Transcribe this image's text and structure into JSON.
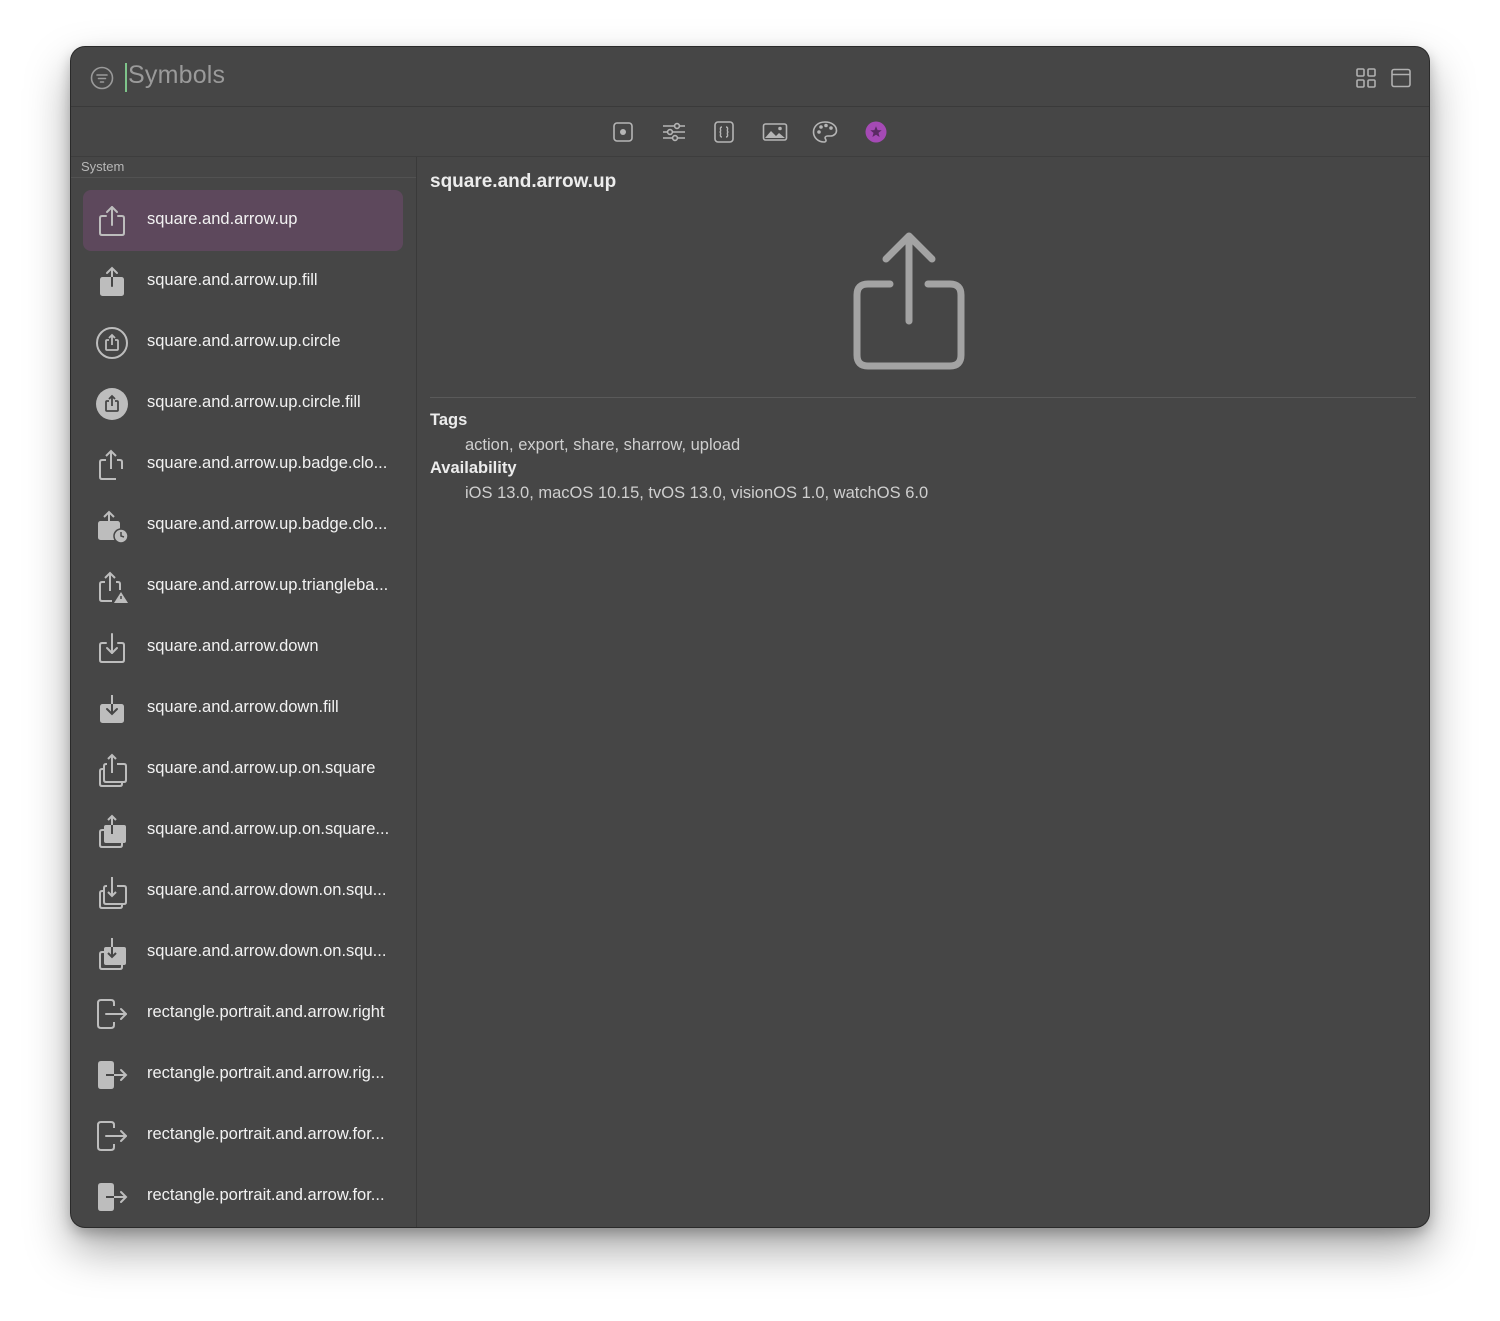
{
  "search": {
    "text": "Symbols"
  },
  "section": {
    "label": "System"
  },
  "symbols": [
    {
      "name": "square.and.arrow.up",
      "icon": "square-arrow-up-icon"
    },
    {
      "name": "square.and.arrow.up.fill",
      "icon": "square-arrow-up-fill-icon"
    },
    {
      "name": "square.and.arrow.up.circle",
      "icon": "square-arrow-up-circle-icon"
    },
    {
      "name": "square.and.arrow.up.circle.fill",
      "icon": "square-arrow-up-circle-fill-icon"
    },
    {
      "name": "square.and.arrow.up.badge.clo...",
      "icon": "square-arrow-up-badge-clock-icon"
    },
    {
      "name": "square.and.arrow.up.badge.clo...",
      "icon": "square-arrow-up-badge-clock-fill-icon"
    },
    {
      "name": "square.and.arrow.up.triangleba...",
      "icon": "square-arrow-up-trianglebadge-icon"
    },
    {
      "name": "square.and.arrow.down",
      "icon": "square-arrow-down-icon"
    },
    {
      "name": "square.and.arrow.down.fill",
      "icon": "square-arrow-down-fill-icon"
    },
    {
      "name": "square.and.arrow.up.on.square",
      "icon": "square-arrow-up-on-square-icon"
    },
    {
      "name": "square.and.arrow.up.on.square...",
      "icon": "square-arrow-up-on-square-fill-icon"
    },
    {
      "name": "square.and.arrow.down.on.squ...",
      "icon": "square-arrow-down-on-square-icon"
    },
    {
      "name": "square.and.arrow.down.on.squ...",
      "icon": "square-arrow-down-on-square-fill-icon"
    },
    {
      "name": "rectangle.portrait.and.arrow.right",
      "icon": "rectangle-portrait-arrow-right-icon"
    },
    {
      "name": "rectangle.portrait.and.arrow.rig...",
      "icon": "rectangle-portrait-arrow-right-fill-icon"
    },
    {
      "name": "rectangle.portrait.and.arrow.for...",
      "icon": "rectangle-portrait-arrow-forward-icon"
    },
    {
      "name": "rectangle.portrait.and.arrow.for...",
      "icon": "rectangle-portrait-arrow-forward-fill-icon"
    }
  ],
  "detail": {
    "title": "square.and.arrow.up",
    "tags_label": "Tags",
    "tags": "action, export, share, sharrow, upload",
    "availability_label": "Availability",
    "availability": "iOS 13.0, macOS 10.15, tvOS 13.0, visionOS 1.0, watchOS 6.0"
  },
  "toolbar": {
    "tools": [
      "rendering-mode-icon",
      "sliders-icon",
      "code-braces-icon",
      "photo-icon",
      "palette-icon",
      "favorite-star-icon"
    ],
    "active_color": "#a54ab5"
  },
  "colors": {
    "selected_row": "#5d485c",
    "window_bg": "#464646",
    "caret": "#7ec48a"
  }
}
